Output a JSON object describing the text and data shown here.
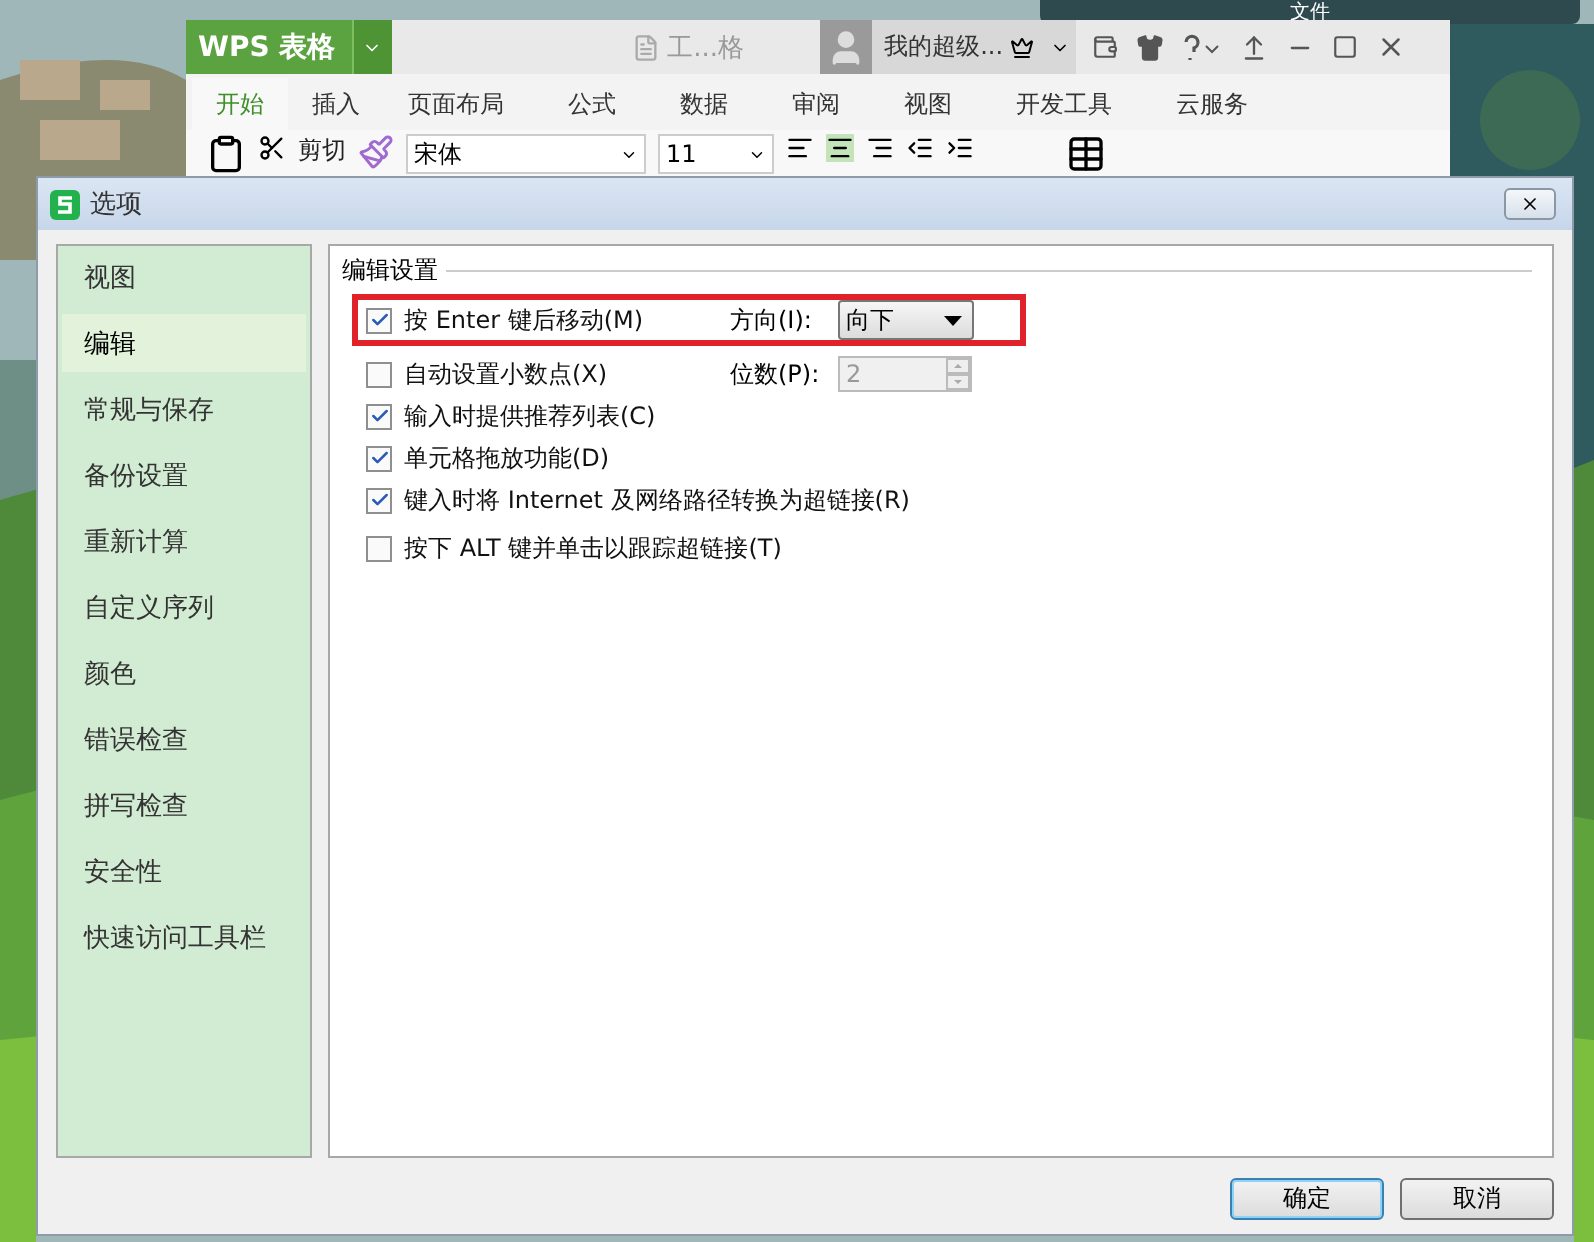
{
  "background_window": {
    "title": "文件"
  },
  "app": {
    "logo": "WPS 表格",
    "document": "工...格",
    "user": "我的超级...",
    "tabs": [
      {
        "label": "开始",
        "selected": true
      },
      {
        "label": "插入",
        "selected": false
      },
      {
        "label": "页面布局",
        "selected": false
      },
      {
        "label": "公式",
        "selected": false
      },
      {
        "label": "数据",
        "selected": false
      },
      {
        "label": "审阅",
        "selected": false
      },
      {
        "label": "视图",
        "selected": false
      },
      {
        "label": "开发工具",
        "selected": false
      },
      {
        "label": "云服务",
        "selected": false
      }
    ],
    "toolbar": {
      "cut": "剪切",
      "font": "宋体",
      "size": "11"
    }
  },
  "dialog": {
    "title": "选项",
    "nav": [
      {
        "label": "视图",
        "selected": false
      },
      {
        "label": "编辑",
        "selected": true
      },
      {
        "label": "常规与保存",
        "selected": false
      },
      {
        "label": "备份设置",
        "selected": false
      },
      {
        "label": "重新计算",
        "selected": false
      },
      {
        "label": "自定义序列",
        "selected": false
      },
      {
        "label": "颜色",
        "selected": false
      },
      {
        "label": "错误检查",
        "selected": false
      },
      {
        "label": "拼写检查",
        "selected": false
      },
      {
        "label": "安全性",
        "selected": false
      },
      {
        "label": "快速访问工具栏",
        "selected": false
      }
    ],
    "section": "编辑设置",
    "options": [
      {
        "label": "按 Enter 键后移动(M)",
        "checked": true,
        "highlighted": true,
        "extra": {
          "kind": "dropdown",
          "label": "方向(I):",
          "value": "向下",
          "disabled": false
        }
      },
      {
        "label": "自动设置小数点(X)",
        "checked": false,
        "highlighted": false,
        "extra": {
          "kind": "spinner",
          "label": "位数(P):",
          "value": "2",
          "disabled": true
        }
      },
      {
        "label": "输入时提供推荐列表(C)",
        "checked": true,
        "highlighted": false
      },
      {
        "label": "单元格拖放功能(D)",
        "checked": true,
        "highlighted": false
      },
      {
        "label": "键入时将 Internet 及网络路径转换为超链接(R)",
        "checked": true,
        "highlighted": false
      },
      {
        "label": "按下 ALT 键并单击以跟踪超链接(T)",
        "checked": false,
        "highlighted": false
      }
    ],
    "buttons": [
      {
        "label": "确定",
        "default": true
      },
      {
        "label": "取消",
        "default": false
      }
    ]
  }
}
